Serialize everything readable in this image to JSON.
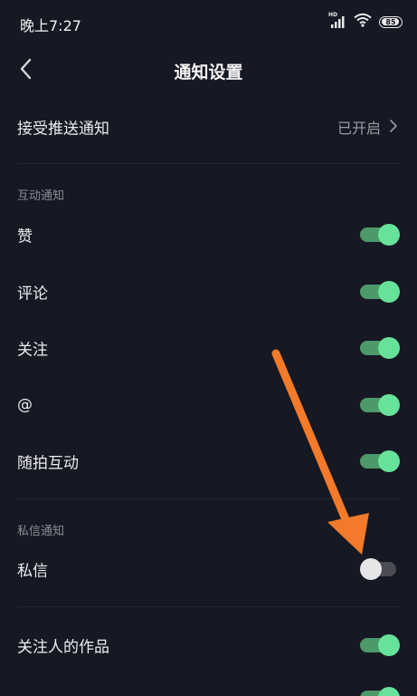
{
  "status_bar": {
    "time": "晚上7:27",
    "network_label": "HD",
    "battery_level": "85"
  },
  "header": {
    "title": "通知设置",
    "back_icon": "chevron-left-icon"
  },
  "push_row": {
    "label": "接受推送通知",
    "value": "已开启"
  },
  "interaction_section": {
    "title": "互动通知",
    "items": [
      {
        "label": "赞",
        "enabled": true
      },
      {
        "label": "评论",
        "enabled": true
      },
      {
        "label": "关注",
        "enabled": true
      },
      {
        "label": "@",
        "enabled": true
      },
      {
        "label": "随拍互动",
        "enabled": true
      }
    ]
  },
  "message_section": {
    "title": "私信通知",
    "items": [
      {
        "label": "私信",
        "enabled": false
      }
    ]
  },
  "follow_section": {
    "items": [
      {
        "label": "关注人的作品",
        "enabled": true
      }
    ]
  },
  "colors": {
    "background": "#161823",
    "toggle_on": "#67e29a",
    "toggle_off": "#e6e6e8",
    "annotation_arrow": "#f27a2a"
  }
}
